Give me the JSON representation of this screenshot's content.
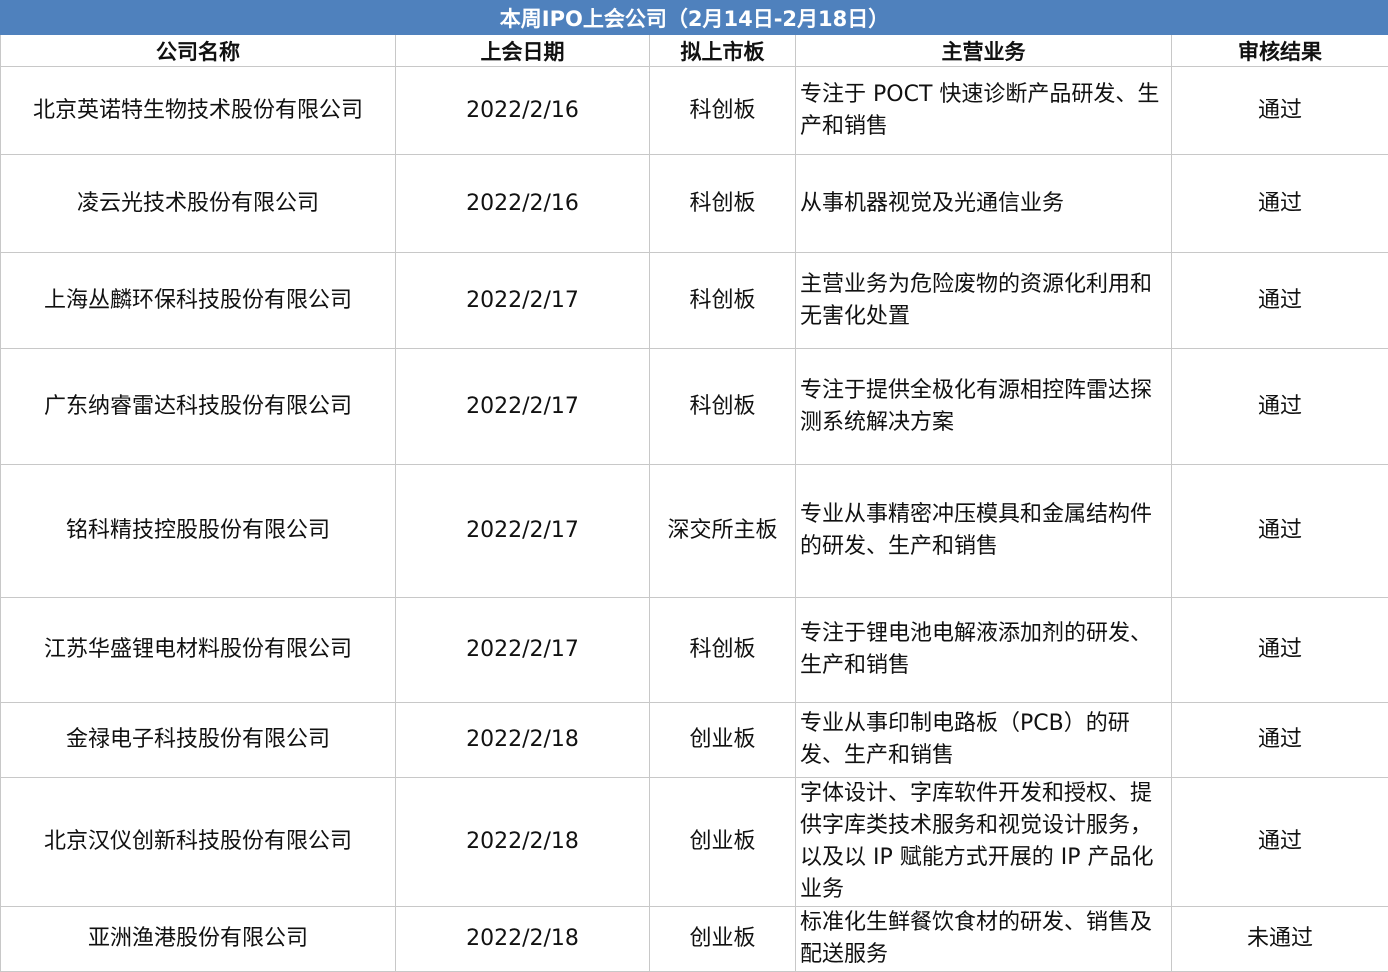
{
  "title": "本周IPO上会公司（2月14日-2月18日）",
  "columns": [
    "公司名称",
    "上会日期",
    "拟上市板",
    "主营业务",
    "审核结果"
  ],
  "rows": [
    {
      "company": "北京英诺特生物技术股份有限公司",
      "date": "2022/2/16",
      "board": "科创板",
      "business": "专注于 POCT 快速诊断产品研发、生产和销售",
      "result": "通过"
    },
    {
      "company": "凌云光技术股份有限公司",
      "date": "2022/2/16",
      "board": "科创板",
      "business": "从事机器视觉及光通信业务",
      "result": "通过"
    },
    {
      "company": "上海丛麟环保科技股份有限公司",
      "date": "2022/2/17",
      "board": "科创板",
      "business": "主营业务为危险废物的资源化利用和无害化处置",
      "result": "通过"
    },
    {
      "company": "广东纳睿雷达科技股份有限公司",
      "date": "2022/2/17",
      "board": "科创板",
      "business": "专注于提供全极化有源相控阵雷达探测系统解决方案",
      "result": "通过"
    },
    {
      "company": "铭科精技控股股份有限公司",
      "date": "2022/2/17",
      "board": "深交所主板",
      "business": "专业从事精密冲压模具和金属结构件的研发、生产和销售",
      "result": "通过"
    },
    {
      "company": "江苏华盛锂电材料股份有限公司",
      "date": "2022/2/17",
      "board": "科创板",
      "business": "专注于锂电池电解液添加剂的研发、生产和销售",
      "result": "通过"
    },
    {
      "company": "金禄电子科技股份有限公司",
      "date": "2022/2/18",
      "board": "创业板",
      "business": "专业从事印制电路板（PCB）的研发、生产和销售",
      "result": "通过"
    },
    {
      "company": "北京汉仪创新科技股份有限公司",
      "date": "2022/2/18",
      "board": "创业板",
      "business": "字体设计、字库软件开发和授权、提供字库类技术服务和视觉设计服务，以及以 IP 赋能方式开展的 IP 产品化业务",
      "result": "通过"
    },
    {
      "company": "亚洲渔港股份有限公司",
      "date": "2022/2/18",
      "board": "创业板",
      "business": "标准化生鲜餐饮食材的研发、销售及配送服务",
      "result": "未通过"
    }
  ]
}
